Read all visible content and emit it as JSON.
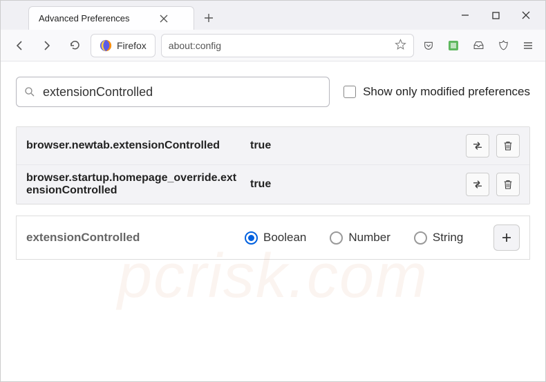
{
  "window": {
    "tab_title": "Advanced Preferences"
  },
  "toolbar": {
    "identity_label": "Firefox",
    "url": "about:config"
  },
  "search": {
    "value": "extensionControlled",
    "checkbox_label": "Show only modified preferences"
  },
  "prefs": [
    {
      "name": "browser.newtab.extensionControlled",
      "value": "true"
    },
    {
      "name": "browser.startup.homepage_override.extensionControlled",
      "value": "true"
    }
  ],
  "add": {
    "name": "extensionControlled",
    "types": [
      "Boolean",
      "Number",
      "String"
    ],
    "selected": 0
  },
  "watermark": "pcrisk.com"
}
